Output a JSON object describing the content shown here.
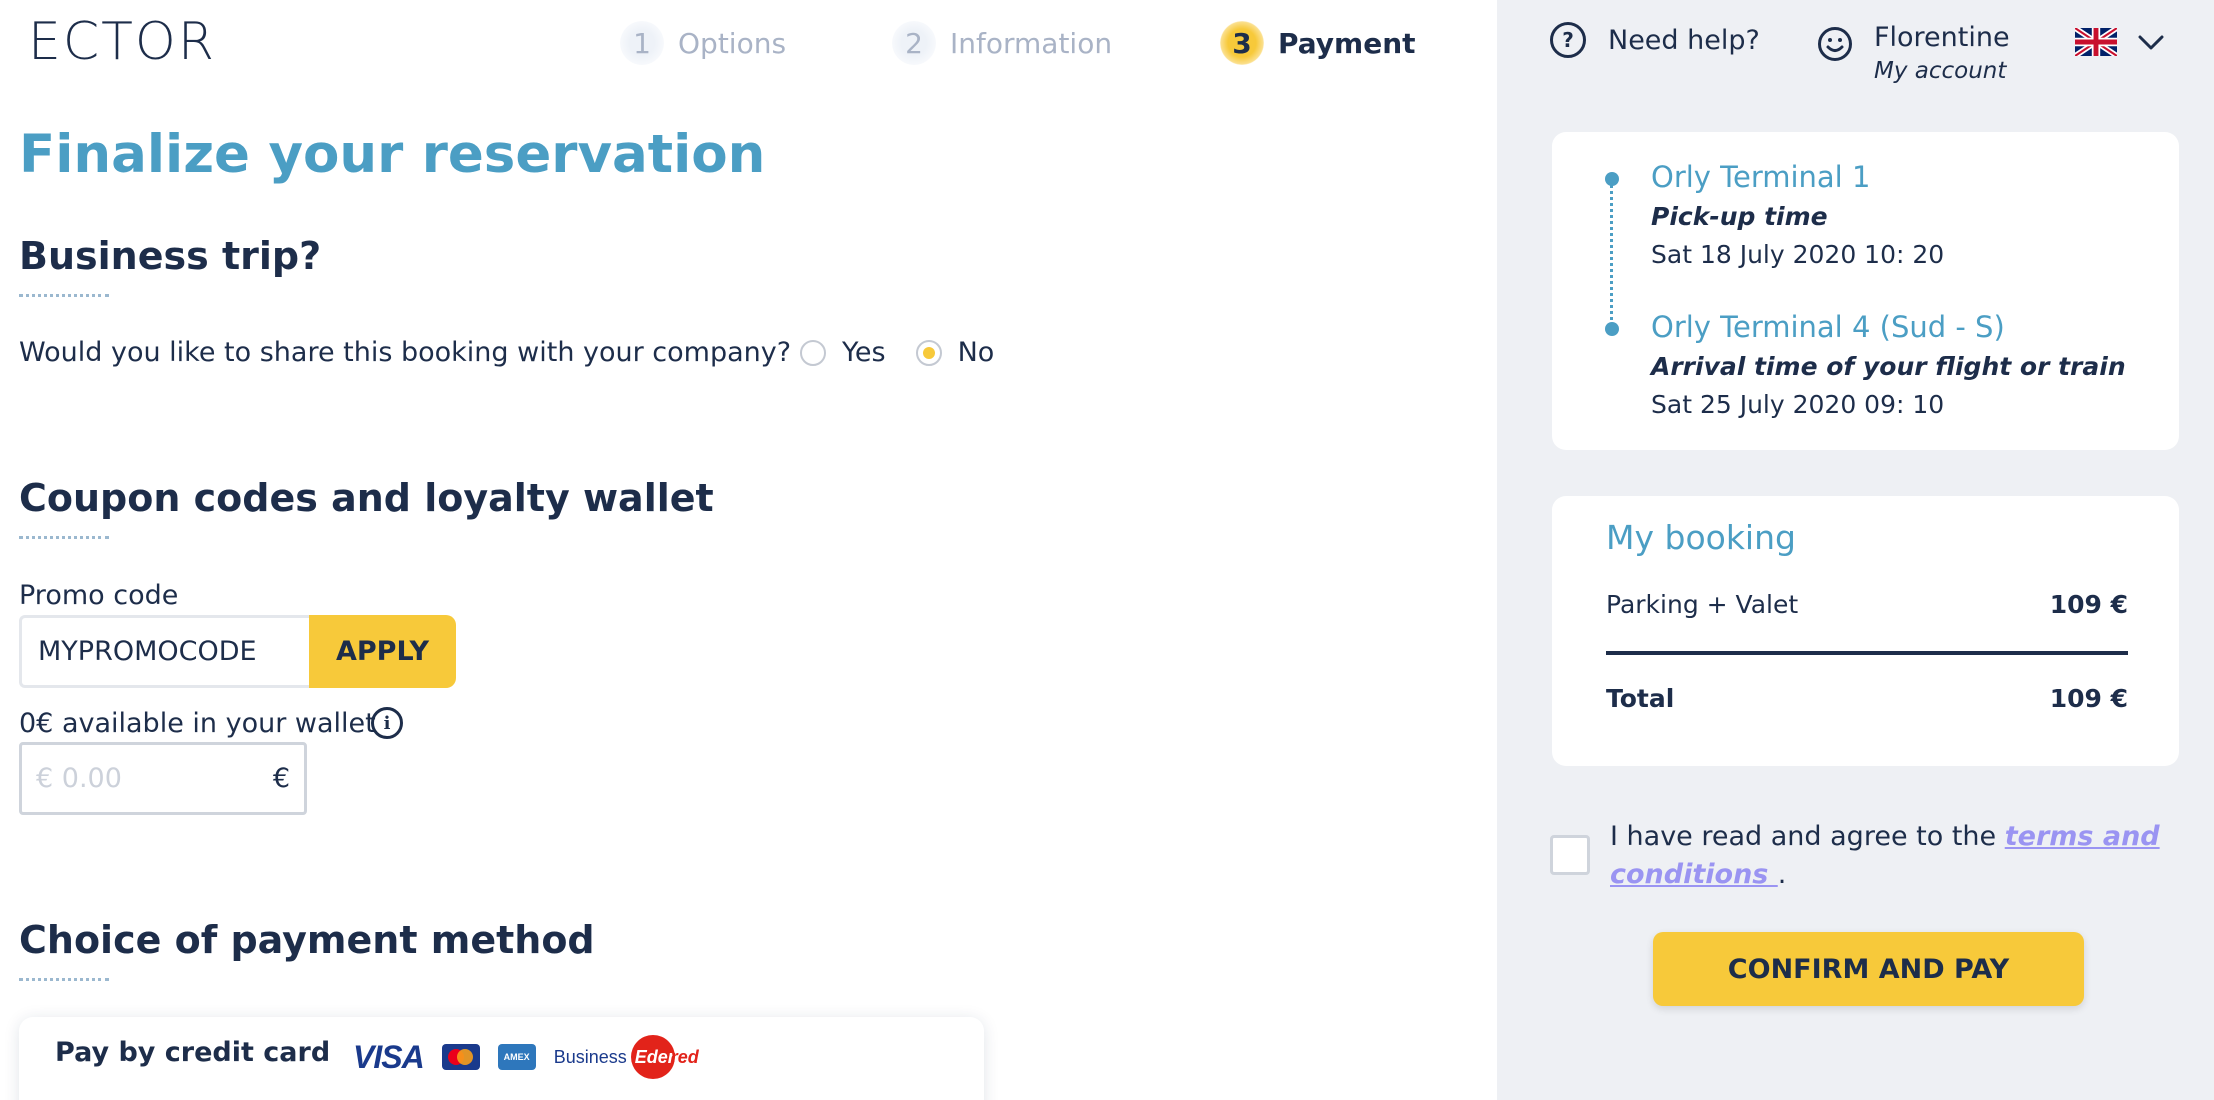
{
  "header": {
    "logo": "ECTOR",
    "steps": [
      {
        "number": "1",
        "label": "Options",
        "active": false
      },
      {
        "number": "2",
        "label": "Information",
        "active": false
      },
      {
        "number": "3",
        "label": "Payment",
        "active": true
      }
    ]
  },
  "main": {
    "title": "Finalize your reservation",
    "business": {
      "title": "Business trip?",
      "question": "Would you like to share this booking with your company?",
      "options": [
        {
          "label": "Yes",
          "checked": false
        },
        {
          "label": "No",
          "checked": true
        }
      ]
    },
    "coupons": {
      "title": "Coupon codes and loyalty wallet",
      "promo_label": "Promo code",
      "promo_value": "MYPROMOCODE",
      "apply_label": "APPLY",
      "wallet_label": "0€ available in your wallet",
      "info_glyph": "i",
      "wallet_placeholder": "€ 0.00",
      "wallet_currency": "€"
    },
    "payment": {
      "title": "Choice of payment method",
      "card_title": "Pay by credit card",
      "logos": {
        "visa": "VISA",
        "amex": "AMEX",
        "edenred_prefix": "Business",
        "edenred_circle": "Eden",
        "edenred_tail": "red"
      }
    }
  },
  "sidebar": {
    "help_icon": "?",
    "help_label": "Need help?",
    "account_name": "Florentine",
    "account_sub": "My account",
    "trip": {
      "origin": "Orly Terminal 1",
      "origin_label": "Pick-up time",
      "origin_date": "Sat 18 July 2020 10: 20",
      "destination": "Orly Terminal 4 (Sud - S)",
      "destination_label": "Arrival time of your flight or train",
      "destination_date": "Sat 25 July 2020 09: 10"
    },
    "booking": {
      "title": "My booking",
      "item_label": "Parking + Valet",
      "item_price": "109 €",
      "total_label": "Total",
      "total_price": "109 €"
    },
    "terms": {
      "prefix": "I have read and agree to the ",
      "link": "terms and conditions ",
      "suffix": "."
    },
    "confirm_label": "CONFIRM AND PAY"
  },
  "colors": {
    "accent_blue": "#4b9ec4",
    "brand_yellow": "#f7c93a",
    "navy": "#1d2d4a",
    "sidebar_bg": "#eef0f4",
    "link_purple": "#9a94f2"
  },
  "icons": [
    "help-icon",
    "smiley-icon",
    "uk-flag-icon",
    "chevron-down-icon",
    "info-icon"
  ]
}
